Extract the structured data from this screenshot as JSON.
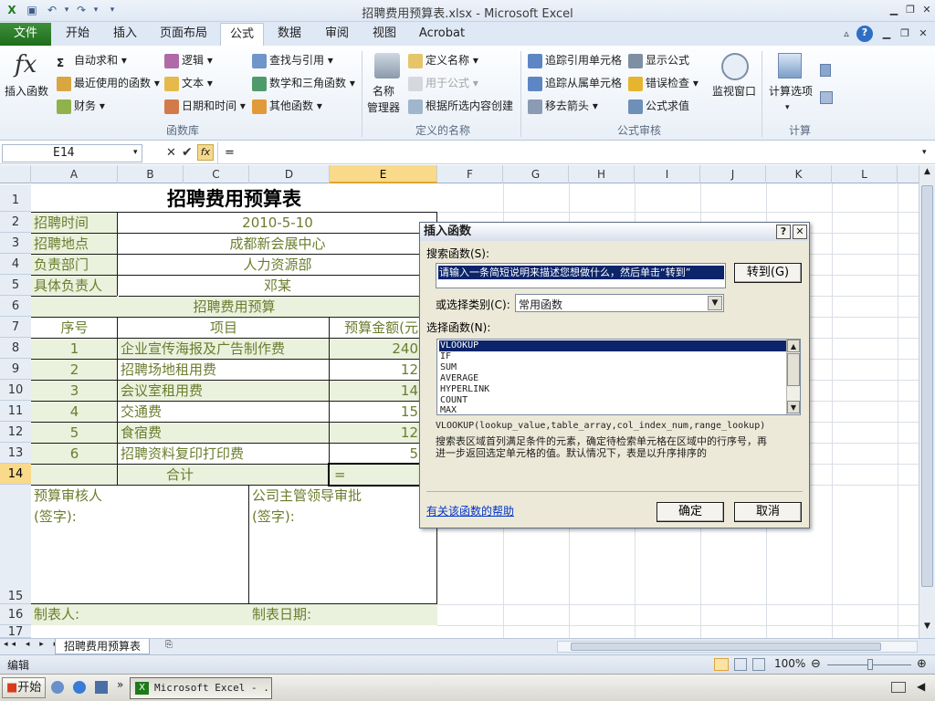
{
  "window": {
    "title": "招聘费用预算表.xlsx  -  Microsoft Excel"
  },
  "qat": {
    "save_icon": "save-icon",
    "undo_icon": "undo-icon",
    "redo_icon": "redo-icon"
  },
  "tabs": {
    "file": "文件",
    "items": [
      "开始",
      "插入",
      "页面布局",
      "公式",
      "数据",
      "审阅",
      "视图",
      "Acrobat"
    ],
    "active": "公式"
  },
  "ribbon": {
    "insert_function": "插入函数",
    "autosum": "自动求和",
    "recent": "最近使用的函数",
    "financial": "财务",
    "logical": "逻辑",
    "text": "文本",
    "datetime": "日期和时间",
    "lookup": "查找与引用",
    "math": "数学和三角函数",
    "other": "其他函数",
    "group_library": "函数库",
    "name_manager_1": "名称",
    "name_manager_2": "管理器",
    "define_name": "定义名称",
    "use_in_formula": "用于公式",
    "create_from_selection": "根据所选内容创建",
    "group_names": "定义的名称",
    "trace_precedents": "追踪引用单元格",
    "trace_dependents": "追踪从属单元格",
    "remove_arrows": "移去箭头",
    "show_formulas": "显示公式",
    "error_checking": "错误检查",
    "evaluate_formula": "公式求值",
    "group_audit": "公式审核",
    "watch_window": "监视窗口",
    "calc_options": "计算选项",
    "group_calc": "计算"
  },
  "formula_bar": {
    "name_box": "E14",
    "fx": "fx",
    "content": "="
  },
  "columns": [
    "A",
    "B",
    "C",
    "D",
    "E",
    "F",
    "G",
    "H",
    "I",
    "J",
    "K",
    "L"
  ],
  "selected_column": "E",
  "rows": [
    "1",
    "2",
    "3",
    "4",
    "5",
    "6",
    "7",
    "8",
    "9",
    "10",
    "11",
    "12",
    "13",
    "14",
    "15",
    "16",
    "17"
  ],
  "selected_row": "14",
  "sheet": {
    "title": "招聘费用预算表",
    "info": [
      {
        "label": "招聘时间",
        "value": "2010-5-10"
      },
      {
        "label": "招聘地点",
        "value": "成都新会展中心"
      },
      {
        "label": "负责部门",
        "value": "人力资源部"
      },
      {
        "label": "具体负责人",
        "value": "邓某"
      }
    ],
    "section": "招聘费用预算",
    "headers": [
      "序号",
      "项目",
      "预算金额(元)"
    ],
    "items": [
      {
        "no": "1",
        "name": "企业宣传海报及广告制作费",
        "amount": "240"
      },
      {
        "no": "2",
        "name": "招聘场地租用费",
        "amount": "12"
      },
      {
        "no": "3",
        "name": "会议室租用费",
        "amount": "14"
      },
      {
        "no": "4",
        "name": "交通费",
        "amount": "15"
      },
      {
        "no": "5",
        "name": "食宿费",
        "amount": "12"
      },
      {
        "no": "6",
        "name": "招聘资料复印打印费",
        "amount": "5"
      }
    ],
    "total_label": "合计",
    "total_value": "=",
    "reviewer": "预算审核人",
    "sign1": "(签字):",
    "approver": "公司主管领导审批",
    "sign2": "(签字):",
    "maker": "制表人:",
    "date": "制表日期:"
  },
  "dialog": {
    "title": "插入函数",
    "help_btn": "?",
    "close_btn": "✕",
    "search_label": "搜索函数(S):",
    "search_value": "请输入一条简短说明来描述您想做什么，然后单击“转到”",
    "go_button": "转到(G)",
    "category_label": "或选择类别(C):",
    "category_value": "常用函数",
    "select_label": "选择函数(N):",
    "functions": [
      "VLOOKUP",
      "IF",
      "SUM",
      "AVERAGE",
      "HYPERLINK",
      "COUNT",
      "MAX"
    ],
    "selected_function": "VLOOKUP",
    "signature": "VLOOKUP(lookup_value,table_array,col_index_num,range_lookup)",
    "description_1": "搜索表区域首列满足条件的元素，确定待检索单元格在区域中的行序号，再",
    "description_2": "进一步返回选定单元格的值。默认情况下，表是以升序排序的",
    "help_link": "有关该函数的帮助",
    "ok": "确定",
    "cancel": "取消"
  },
  "sheet_tab": "招聘费用预算表",
  "status": {
    "mode": "编辑",
    "zoom": "100%"
  },
  "taskbar": {
    "start": "开始",
    "task": "Microsoft Excel - ..."
  }
}
